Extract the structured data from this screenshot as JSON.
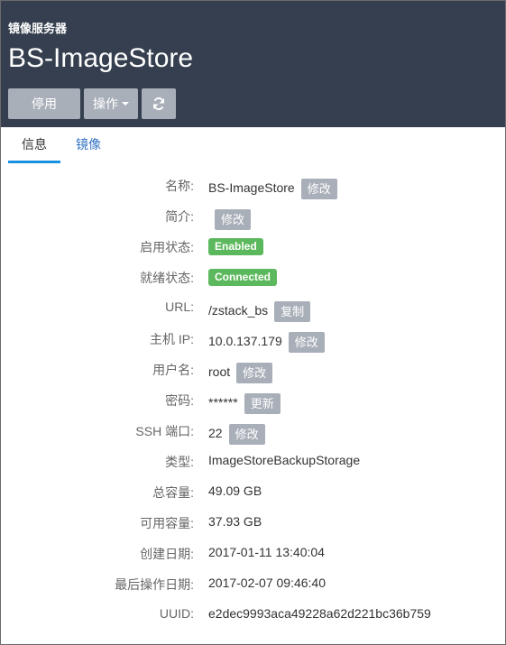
{
  "header": {
    "subtitle": "镜像服务器",
    "title": "BS-ImageStore"
  },
  "toolbar": {
    "disable_label": "停用",
    "operations_label": "操作",
    "refresh_icon": "refresh-icon",
    "caret_icon": "caret-down-icon"
  },
  "tabs": [
    {
      "label": "信息",
      "active": true
    },
    {
      "label": "镜像",
      "active": false
    }
  ],
  "details": {
    "name": {
      "label": "名称:",
      "value": "BS-ImageStore",
      "action": "修改"
    },
    "description": {
      "label": "简介:",
      "value": "",
      "action": "修改"
    },
    "enable_state": {
      "label": "启用状态:",
      "value": "Enabled"
    },
    "ready_state": {
      "label": "就绪状态:",
      "value": "Connected"
    },
    "url": {
      "label": "URL:",
      "value": "/zstack_bs",
      "action": "复制"
    },
    "host_ip": {
      "label": "主机 IP:",
      "value": "10.0.137.179",
      "action": "修改"
    },
    "username": {
      "label": "用户名:",
      "value": "root",
      "action": "修改"
    },
    "password": {
      "label": "密码:",
      "value": "******",
      "action": "更新"
    },
    "ssh_port": {
      "label": "SSH 端口:",
      "value": "22",
      "action": "修改"
    },
    "type": {
      "label": "类型:",
      "value": "ImageStoreBackupStorage"
    },
    "total_capacity": {
      "label": "总容量:",
      "value": "49.09 GB"
    },
    "available_capacity": {
      "label": "可用容量:",
      "value": "37.93 GB"
    },
    "created_date": {
      "label": "创建日期:",
      "value": "2017-01-11 13:40:04"
    },
    "last_op_date": {
      "label": "最后操作日期:",
      "value": "2017-02-07 09:46:40"
    },
    "uuid": {
      "label": "UUID:",
      "value": "e2dec9993aca49228a62d221bc36b759"
    }
  },
  "colors": {
    "header_bg": "#353f4f",
    "button_gray": "#a9afb9",
    "badge_green": "#5cb85c",
    "tab_active_underline": "#1a91e0",
    "link_blue": "#3474c2"
  }
}
